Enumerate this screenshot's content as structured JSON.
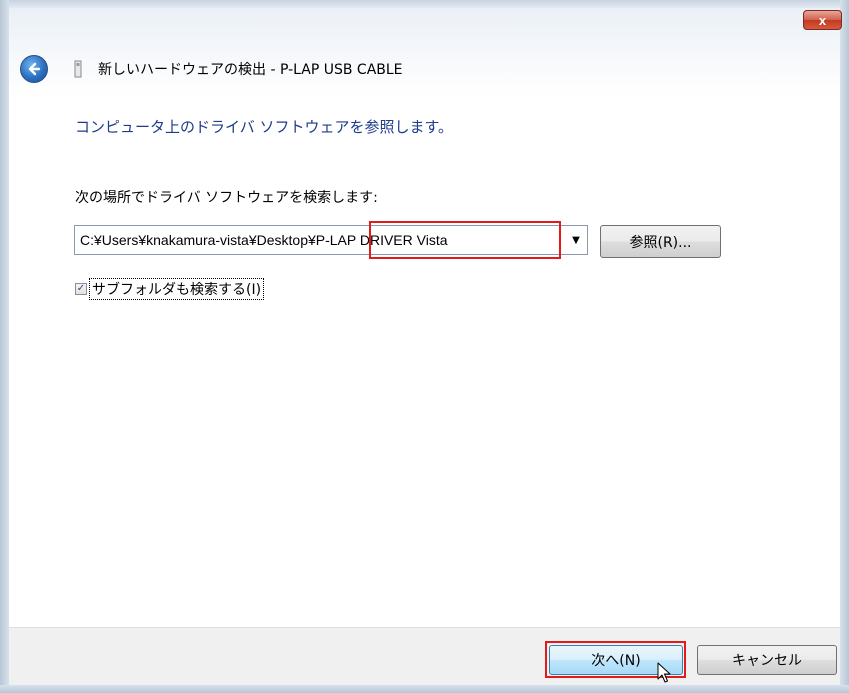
{
  "window": {
    "title": "新しいハードウェアの検出 - P-LAP USB CABLE",
    "close_label": "x",
    "close_icon": "close-icon",
    "back_icon": "back-arrow-icon",
    "device_icon": "usb-device-icon"
  },
  "main": {
    "instruction": "コンピュータ上のドライバ ソフトウェアを参照します。",
    "search_label": "次の場所でドライバ ソフトウェアを検索します:",
    "path_value": "C:¥Users¥knakamura-vista¥Desktop¥P-LAP DRIVER Vista",
    "browse_label": "参照(R)...",
    "subfolder_checkbox": {
      "label": "サブフォルダも検索する(I)",
      "checked": true
    }
  },
  "footer": {
    "next_label": "次へ(N)",
    "cancel_label": "キャンセル"
  },
  "colors": {
    "instruction_text": "#1e3b8a",
    "highlight": "#e11a1a",
    "close_button": "#c23a22",
    "footer_bg": "#f0f0f0"
  }
}
